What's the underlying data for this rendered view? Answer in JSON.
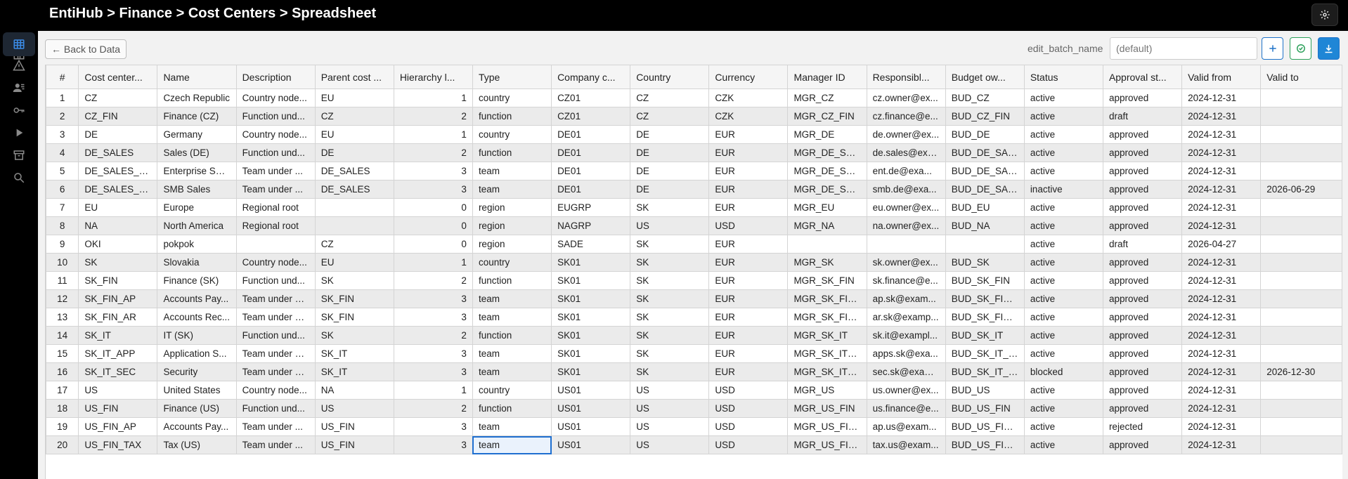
{
  "header": {
    "breadcrumb": "EntiHub > Finance > Cost Centers > Spreadsheet"
  },
  "sidebar": {
    "items": [
      {
        "icon": "home-icon",
        "active": false
      },
      {
        "icon": "table-icon",
        "active": true
      },
      {
        "icon": "warning-icon",
        "active": false
      },
      {
        "icon": "users-icon",
        "active": false
      },
      {
        "icon": "key-icon",
        "active": false
      },
      {
        "icon": "play-icon",
        "active": false
      },
      {
        "icon": "archive-icon",
        "active": false
      },
      {
        "icon": "search-icon",
        "active": false
      }
    ]
  },
  "toolbar": {
    "back_label": "← Back to Data",
    "batch_label": "edit_batch_name",
    "batch_placeholder": "(default)"
  },
  "colors": {
    "accent": "#1f73c9",
    "success": "#2ca05a",
    "selection": "#1f6fd0"
  },
  "table": {
    "columns": [
      "#",
      "Cost center...",
      "Name",
      "Description",
      "Parent cost ...",
      "Hierarchy l...",
      "Type",
      "Company c...",
      "Country",
      "Currency",
      "Manager ID",
      "Responsibl...",
      "Budget ow...",
      "Status",
      "Approval st...",
      "Valid from",
      "Valid to"
    ],
    "rows": [
      [
        "1",
        "CZ",
        "Czech Republic",
        "Country node...",
        "EU",
        "1",
        "country",
        "CZ01",
        "CZ",
        "CZK",
        "MGR_CZ",
        "cz.owner@ex...",
        "BUD_CZ",
        "active",
        "approved",
        "2024-12-31",
        ""
      ],
      [
        "2",
        "CZ_FIN",
        "Finance (CZ)",
        "Function und...",
        "CZ",
        "2",
        "function",
        "CZ01",
        "CZ",
        "CZK",
        "MGR_CZ_FIN",
        "cz.finance@e...",
        "BUD_CZ_FIN",
        "active",
        "draft",
        "2024-12-31",
        ""
      ],
      [
        "3",
        "DE",
        "Germany",
        "Country node...",
        "EU",
        "1",
        "country",
        "DE01",
        "DE",
        "EUR",
        "MGR_DE",
        "de.owner@ex...",
        "BUD_DE",
        "active",
        "approved",
        "2024-12-31",
        ""
      ],
      [
        "4",
        "DE_SALES",
        "Sales (DE)",
        "Function und...",
        "DE",
        "2",
        "function",
        "DE01",
        "DE",
        "EUR",
        "MGR_DE_SAL...",
        "de.sales@exa...",
        "BUD_DE_SALES",
        "active",
        "approved",
        "2024-12-31",
        ""
      ],
      [
        "5",
        "DE_SALES_ENT",
        "Enterprise Sal...",
        "Team under ...",
        "DE_SALES",
        "3",
        "team",
        "DE01",
        "DE",
        "EUR",
        "MGR_DE_SAL...",
        "ent.de@exa...",
        "BUD_DE_SAL...",
        "active",
        "approved",
        "2024-12-31",
        ""
      ],
      [
        "6",
        "DE_SALES_SMB",
        "SMB Sales",
        "Team under ...",
        "DE_SALES",
        "3",
        "team",
        "DE01",
        "DE",
        "EUR",
        "MGR_DE_SAL...",
        "smb.de@exa...",
        "BUD_DE_SAL...",
        "inactive",
        "approved",
        "2024-12-31",
        "2026-06-29"
      ],
      [
        "7",
        "EU",
        "Europe",
        "Regional root",
        "",
        "0",
        "region",
        "EUGRP",
        "SK",
        "EUR",
        "MGR_EU",
        "eu.owner@ex...",
        "BUD_EU",
        "active",
        "approved",
        "2024-12-31",
        ""
      ],
      [
        "8",
        "NA",
        "North America",
        "Regional root",
        "",
        "0",
        "region",
        "NAGRP",
        "US",
        "USD",
        "MGR_NA",
        "na.owner@ex...",
        "BUD_NA",
        "active",
        "approved",
        "2024-12-31",
        ""
      ],
      [
        "9",
        "OKI",
        "pokpok",
        "",
        "CZ",
        "0",
        "region",
        "SADE",
        "SK",
        "EUR",
        "",
        "",
        "",
        "active",
        "draft",
        "2026-04-27",
        ""
      ],
      [
        "10",
        "SK",
        "Slovakia",
        "Country node...",
        "EU",
        "1",
        "country",
        "SK01",
        "SK",
        "EUR",
        "MGR_SK",
        "sk.owner@ex...",
        "BUD_SK",
        "active",
        "approved",
        "2024-12-31",
        ""
      ],
      [
        "11",
        "SK_FIN",
        "Finance (SK)",
        "Function und...",
        "SK",
        "2",
        "function",
        "SK01",
        "SK",
        "EUR",
        "MGR_SK_FIN",
        "sk.finance@e...",
        "BUD_SK_FIN",
        "active",
        "approved",
        "2024-12-31",
        ""
      ],
      [
        "12",
        "SK_FIN_AP",
        "Accounts Pay...",
        "Team under S...",
        "SK_FIN",
        "3",
        "team",
        "SK01",
        "SK",
        "EUR",
        "MGR_SK_FIN_...",
        "ap.sk@exam...",
        "BUD_SK_FIN_...",
        "active",
        "approved",
        "2024-12-31",
        ""
      ],
      [
        "13",
        "SK_FIN_AR",
        "Accounts Rec...",
        "Team under S...",
        "SK_FIN",
        "3",
        "team",
        "SK01",
        "SK",
        "EUR",
        "MGR_SK_FIN_...",
        "ar.sk@examp...",
        "BUD_SK_FIN_...",
        "active",
        "approved",
        "2024-12-31",
        ""
      ],
      [
        "14",
        "SK_IT",
        "IT (SK)",
        "Function und...",
        "SK",
        "2",
        "function",
        "SK01",
        "SK",
        "EUR",
        "MGR_SK_IT",
        "sk.it@exampl...",
        "BUD_SK_IT",
        "active",
        "approved",
        "2024-12-31",
        ""
      ],
      [
        "15",
        "SK_IT_APP",
        "Application S...",
        "Team under S...",
        "SK_IT",
        "3",
        "team",
        "SK01",
        "SK",
        "EUR",
        "MGR_SK_IT_A...",
        "apps.sk@exa...",
        "BUD_SK_IT_A...",
        "active",
        "approved",
        "2024-12-31",
        ""
      ],
      [
        "16",
        "SK_IT_SEC",
        "Security",
        "Team under S...",
        "SK_IT",
        "3",
        "team",
        "SK01",
        "SK",
        "EUR",
        "MGR_SK_IT_S...",
        "sec.sk@exam...",
        "BUD_SK_IT_SEC",
        "blocked",
        "approved",
        "2024-12-31",
        "2026-12-30"
      ],
      [
        "17",
        "US",
        "United States",
        "Country node...",
        "NA",
        "1",
        "country",
        "US01",
        "US",
        "USD",
        "MGR_US",
        "us.owner@ex...",
        "BUD_US",
        "active",
        "approved",
        "2024-12-31",
        ""
      ],
      [
        "18",
        "US_FIN",
        "Finance (US)",
        "Function und...",
        "US",
        "2",
        "function",
        "US01",
        "US",
        "USD",
        "MGR_US_FIN",
        "us.finance@e...",
        "BUD_US_FIN",
        "active",
        "approved",
        "2024-12-31",
        ""
      ],
      [
        "19",
        "US_FIN_AP",
        "Accounts Pay...",
        "Team under ...",
        "US_FIN",
        "3",
        "team",
        "US01",
        "US",
        "USD",
        "MGR_US_FIN...",
        "ap.us@exam...",
        "BUD_US_FIN_...",
        "active",
        "rejected",
        "2024-12-31",
        ""
      ],
      [
        "20",
        "US_FIN_TAX",
        "Tax (US)",
        "Team under ...",
        "US_FIN",
        "3",
        "team",
        "US01",
        "US",
        "USD",
        "MGR_US_FIN...",
        "tax.us@exam...",
        "BUD_US_FIN_...",
        "active",
        "approved",
        "2024-12-31",
        ""
      ]
    ],
    "selected_cell": {
      "row": 20,
      "column": "Type"
    }
  }
}
